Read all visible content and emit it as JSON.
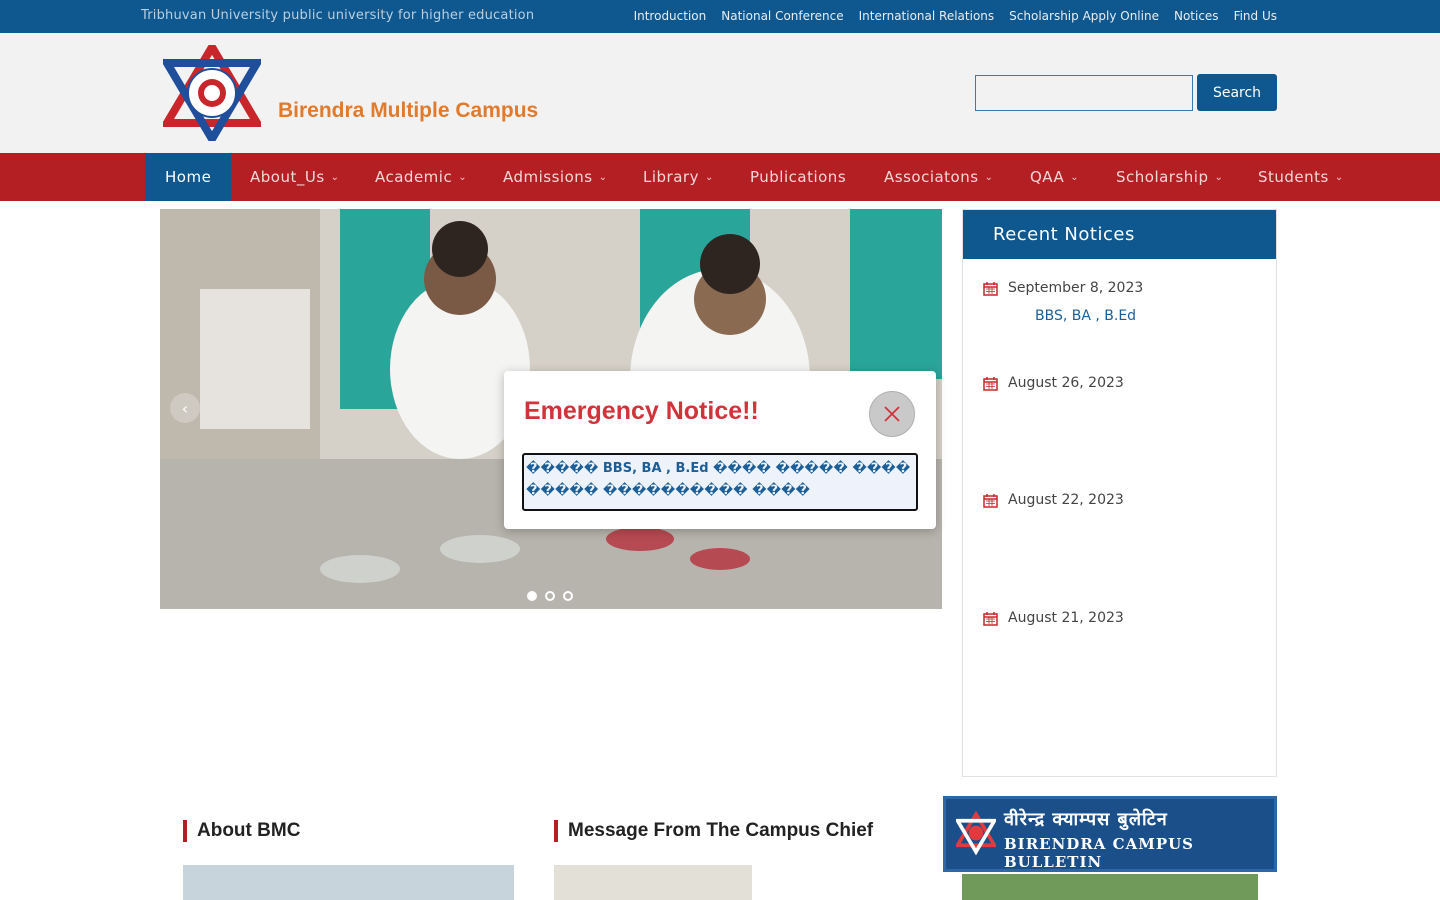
{
  "topbar": {
    "tagline": "Tribhuvan University public university for higher education",
    "links": [
      "Introduction",
      "National Conference",
      "International Relations",
      "Scholarship Apply Online",
      "Notices",
      "Find Us"
    ]
  },
  "header": {
    "site_title": "Birendra Multiple Campus",
    "search_placeholder": "",
    "search_button": "Search"
  },
  "nav": {
    "items": [
      {
        "label": "Home",
        "has_dropdown": false,
        "active": true
      },
      {
        "label": "About_Us",
        "has_dropdown": true
      },
      {
        "label": "Academic",
        "has_dropdown": true
      },
      {
        "label": "Admissions",
        "has_dropdown": true
      },
      {
        "label": "Library",
        "has_dropdown": true
      },
      {
        "label": "Publications",
        "has_dropdown": false
      },
      {
        "label": "Associatons",
        "has_dropdown": true
      },
      {
        "label": "QAA",
        "has_dropdown": true
      },
      {
        "label": "Scholarship",
        "has_dropdown": true
      },
      {
        "label": "Students",
        "has_dropdown": true
      }
    ],
    "caret": "⌄"
  },
  "slider": {
    "prev_icon": "‹",
    "active_slide": 1,
    "slide_count": 3
  },
  "notices": {
    "heading": "Recent Notices",
    "items": [
      {
        "date": "September 8, 2023",
        "text": "BBS, BA , B.Ed"
      },
      {
        "date": "August 26, 2023",
        "text": ""
      },
      {
        "date": "August 22, 2023",
        "text": ""
      },
      {
        "date": "August 21, 2023",
        "text": ""
      }
    ]
  },
  "sections": {
    "about": "About BMC",
    "message": "Message From The Campus Chief"
  },
  "bulletin": {
    "title": "वीरेन्द्र क्याम्पस बुलेटिन",
    "subtitle": "BIRENDRA CAMPUS BULLETIN"
  },
  "modal": {
    "title": "Emergency Notice!!",
    "link_text": "����� BBS, BA , B.Ed ���� ����� ���� ����� ���������� ����",
    "close_icon": "×"
  },
  "colors": {
    "primary_blue": "#0e578f",
    "nav_red": "#b41f24",
    "title_orange": "#e07a2c",
    "modal_red": "#d2333a"
  }
}
